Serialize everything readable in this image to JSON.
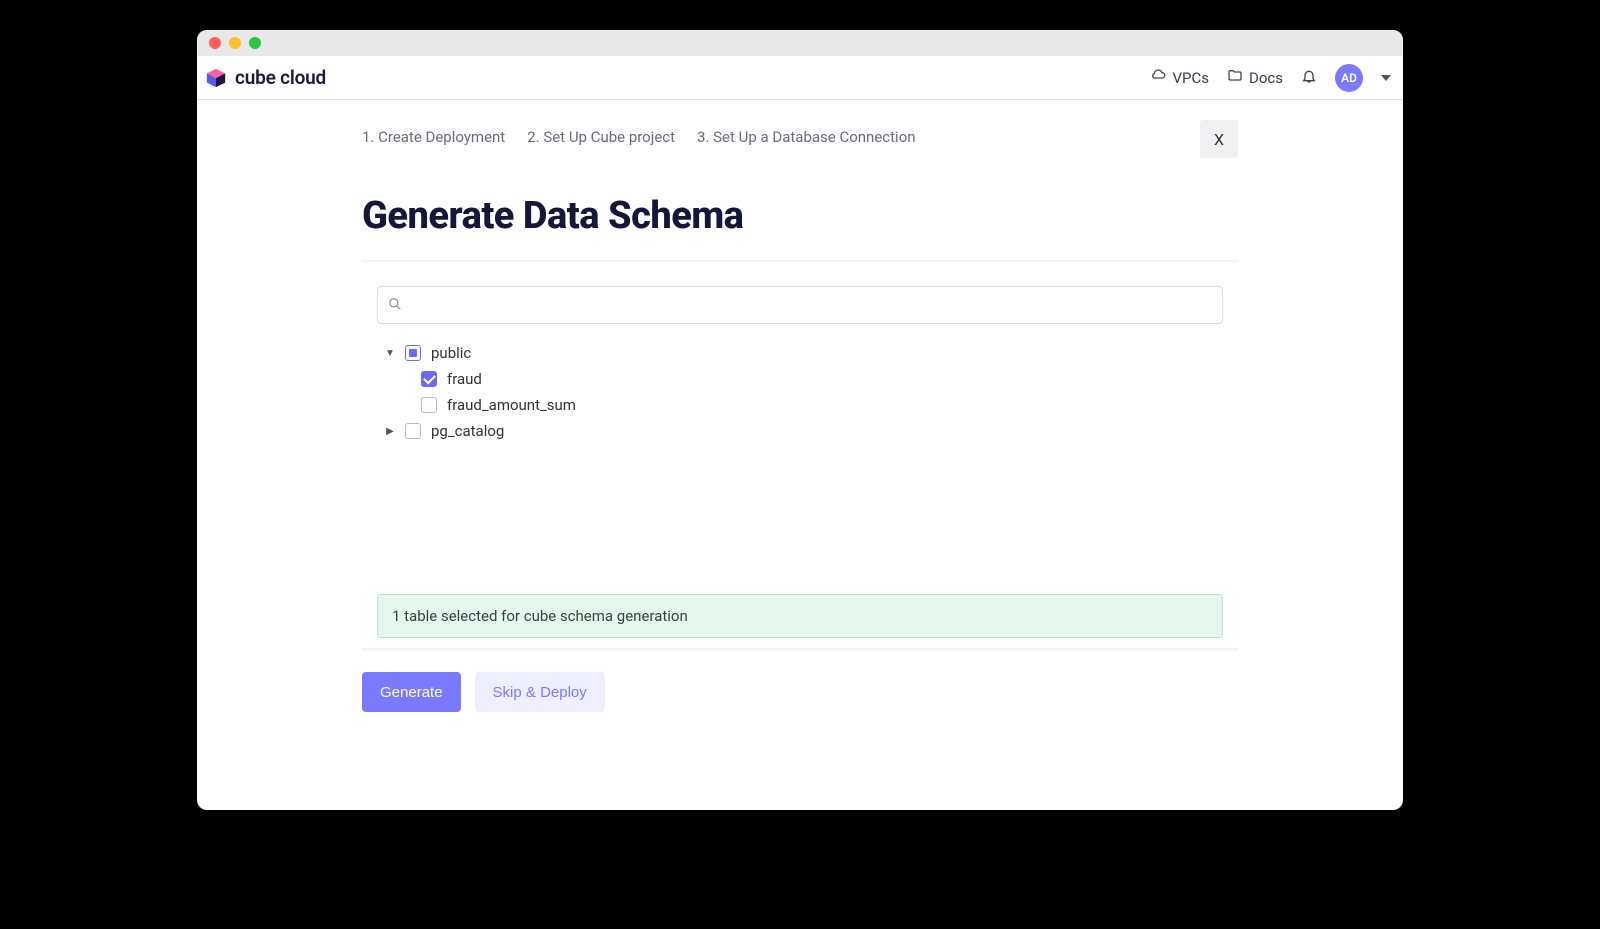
{
  "brand": {
    "name": "cube cloud"
  },
  "nav": {
    "vpcs": "VPCs",
    "docs": "Docs",
    "avatar_initials": "AD"
  },
  "steps": [
    "1. Create Deployment",
    "2. Set Up Cube project",
    "3. Set Up a Database Connection"
  ],
  "close_label": "X",
  "page_title": "Generate Data Schema",
  "search": {
    "placeholder": ""
  },
  "tree": {
    "public": {
      "label": "public",
      "expanded": true,
      "state": "indeterminate",
      "children": [
        {
          "label": "fraud",
          "checked": true
        },
        {
          "label": "fraud_amount_sum",
          "checked": false
        }
      ]
    },
    "pg_catalog": {
      "label": "pg_catalog",
      "expanded": false,
      "state": "unchecked"
    }
  },
  "status": "1 table selected for cube schema generation",
  "buttons": {
    "generate": "Generate",
    "skip": "Skip & Deploy"
  }
}
